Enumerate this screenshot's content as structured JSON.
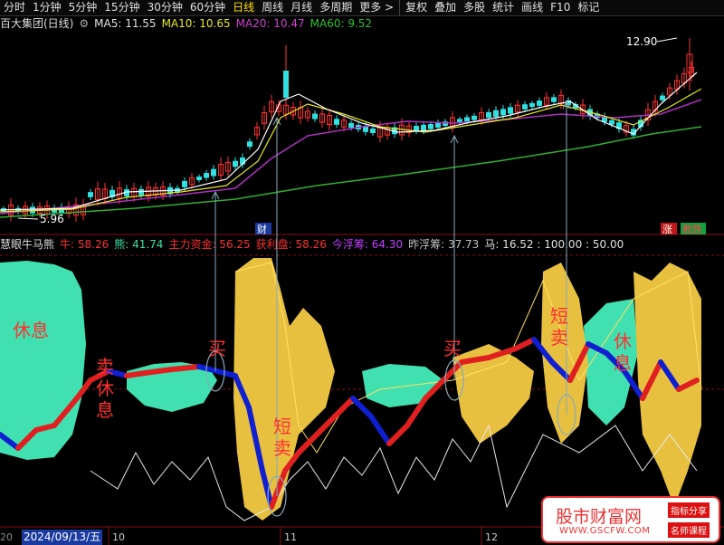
{
  "toolbar": {
    "tabs": [
      "分时",
      "1分钟",
      "5分钟",
      "15分钟",
      "30分钟",
      "60分钟",
      "日线",
      "周线",
      "月线",
      "多周期",
      "更多 >",
      "复权",
      "叠加",
      "多股",
      "统计",
      "画线",
      "F10",
      "标记"
    ],
    "active_index": 6
  },
  "stock": {
    "title": "百大集团(日线)",
    "ma5": "MA5: 11.55",
    "ma10": "MA10: 10.65",
    "ma20": "MA20: 10.47",
    "ma60": "MA60: 9.52",
    "high_label": "12.90",
    "low_label": "5.96",
    "cai_badge": "财",
    "zhang_badge": "涨",
    "jiao_badge": "教跌"
  },
  "indicator": {
    "name": "慧眼牛马熊",
    "items": [
      {
        "text": "牛: 58.26",
        "color": "#ff3030"
      },
      {
        "text": "熊: 41.74",
        "color": "#40e0a0"
      },
      {
        "text": "主力资金: 56.25",
        "color": "#ff3030"
      },
      {
        "text": "获利盘: 58.26",
        "color": "#ff3030"
      },
      {
        "text": "今浮筹: 64.30",
        "color": "#c040ff"
      },
      {
        "text": "昨浮筹: 37.73",
        "color": "#c0c0c0"
      },
      {
        "text": "马: 16.52 : 100.00 : 50.00",
        "color": "#e0e0e0"
      }
    ]
  },
  "annotations": {
    "rest1": "休息",
    "sell_rest": "卖休息",
    "buy1": "买",
    "short_sell1": "短卖",
    "buy2": "买",
    "short_sell2": "短卖",
    "rest2": "休息"
  },
  "axis": {
    "date": "2024/09/13/五",
    "m10": "10",
    "m11": "11",
    "m12": "12",
    "left_cut": "20"
  },
  "watermark": {
    "title": "股市财富网",
    "url": "WWW.GSCFW.COM",
    "tag1": "指标分享",
    "tag2": "名师课程"
  },
  "colors": {
    "up": "#ff3333",
    "down": "#30e0e0",
    "bull": "#e02020",
    "bear": "#1020d0",
    "bear_cloud": "#40e0b0",
    "bull_cloud": "#e8c040"
  }
}
